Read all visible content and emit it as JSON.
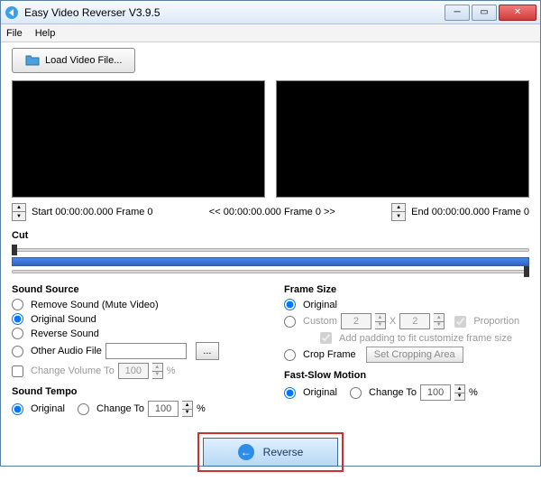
{
  "title": "Easy Video Reverser V3.9.5",
  "menu": {
    "file": "File",
    "help": "Help"
  },
  "load_button": "Load Video File...",
  "time": {
    "start": "Start 00:00:00.000 Frame 0",
    "mid": "<< 00:00:00.000  Frame 0 >>",
    "end": "End 00:00:00.000  Frame 0"
  },
  "cut_label": "Cut",
  "sound_source": {
    "title": "Sound Source",
    "remove": "Remove Sound (Mute Video)",
    "original": "Original Sound",
    "reverse": "Reverse Sound",
    "other": "Other Audio File",
    "browse": "...",
    "change_volume": "Change Volume To",
    "volume_value": "100",
    "percent": "%"
  },
  "sound_tempo": {
    "title": "Sound Tempo",
    "original": "Original",
    "change_to": "Change To",
    "value": "100",
    "percent": "%"
  },
  "frame_size": {
    "title": "Frame Size",
    "original": "Original",
    "custom": "Custom",
    "w": "2",
    "h": "2",
    "x": "X",
    "proportion": "Proportion",
    "padding": "Add padding to fit customize frame size",
    "crop": "Crop Frame",
    "set_crop": "Set Cropping Area"
  },
  "fast_slow": {
    "title": "Fast-Slow Motion",
    "original": "Original",
    "change_to": "Change To",
    "value": "100",
    "percent": "%"
  },
  "reverse_button": "Reverse",
  "icons": {
    "up": "▲",
    "down": "▼"
  }
}
